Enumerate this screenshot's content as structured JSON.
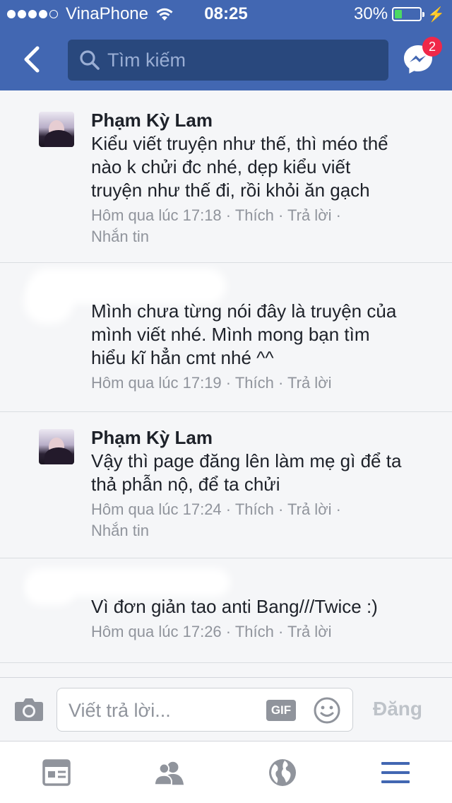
{
  "status_bar": {
    "carrier": "VinaPhone",
    "time": "08:25",
    "battery_percent": "30%",
    "battery_level": 0.3,
    "signal_bars": 4
  },
  "nav": {
    "search_placeholder": "Tìm kiếm",
    "messenger_badge": "2"
  },
  "comments": [
    {
      "author": "Phạm Kỳ Lam",
      "lines": [
        "Kiểu viết truyện như thế, thì méo thể",
        "nào k chửi đc nhé, dẹp kiểu viết",
        "truyện như thế đi, rồi khỏi ăn gạch"
      ],
      "time": "Hôm qua lúc 17:18",
      "like": "Thích",
      "reply": "Trả lời",
      "message": "Nhắn tin"
    },
    {
      "author": "",
      "lines": [
        "Mình chưa từng nói đây là truyện của",
        "mình viết nhé. Mình mong bạn tìm",
        "hiểu kĩ hẳn cmt nhé ^^"
      ],
      "time": "Hôm qua lúc 17:19",
      "like": "Thích",
      "reply": "Trả lời"
    },
    {
      "author": "Phạm Kỳ Lam",
      "lines": [
        "Vậy thì page đăng lên làm mẹ gì để ta",
        "thả phẫn nộ, để ta chửi"
      ],
      "time": "Hôm qua lúc 17:24",
      "like": "Thích",
      "reply": "Trả lời",
      "message": "Nhắn tin"
    },
    {
      "author": "",
      "lines": [
        "Vì đơn giản tao anti Bang///Twice :)"
      ],
      "time": "Hôm qua lúc 17:26",
      "like": "Thích",
      "reply": "Trả lời"
    }
  ],
  "reply_bar": {
    "placeholder": "Viết trả lời...",
    "gif_label": "GIF",
    "post_label": "Đăng"
  },
  "colors": {
    "brand": "#4267b2",
    "search_bg": "#29487d",
    "badge": "#f02849",
    "meta_text": "#90949c",
    "tab_active": "#4267b2",
    "tab_inactive": "#90949c"
  },
  "icons": {
    "back": "chevron-left-icon",
    "search": "search-icon",
    "messenger": "messenger-icon",
    "camera": "camera-icon",
    "smiley": "smiley-icon",
    "tab_news_feed": "news-feed-icon",
    "tab_friends": "friends-icon",
    "tab_notifications": "globe-icon",
    "tab_menu": "menu-icon"
  }
}
